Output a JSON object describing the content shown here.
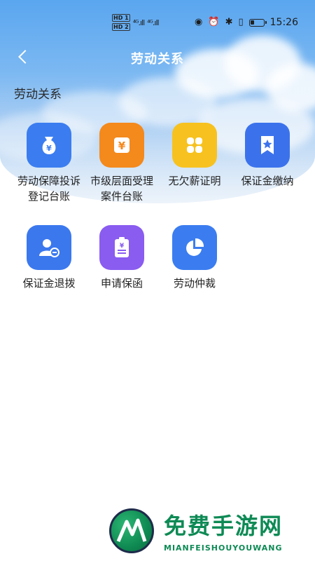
{
  "status_bar": {
    "hd1": "HD 1",
    "hd2": "HD 2",
    "signal1": "⁴ᴳ.ıll",
    "signal2": "⁴ᴳ.ıll",
    "time": "15:26",
    "icons": [
      "eye-icon",
      "alarm-icon",
      "bluetooth-icon",
      "vibrate-icon",
      "battery-icon"
    ]
  },
  "nav": {
    "title": "劳动关系",
    "back_icon": "chevron-left-icon"
  },
  "section": {
    "title": "劳动关系"
  },
  "items": [
    {
      "label": "劳动保障投诉登记台账",
      "icon": "money-bag-icon",
      "color": "#3b7df0"
    },
    {
      "label": "市级层面受理案件台账",
      "icon": "yuan-icon",
      "color": "#f4891c"
    },
    {
      "label": "无欠薪证明",
      "icon": "clover-icon",
      "color": "#f7c21f"
    },
    {
      "label": "保证金缴纳",
      "icon": "bookmark-star-icon",
      "color": "#3b72ec"
    },
    {
      "label": "保证金退拨",
      "icon": "user-minus-icon",
      "color": "#3b78ee"
    },
    {
      "label": "申请保函",
      "icon": "clipboard-yuan-icon",
      "color": "#8a5cf0"
    },
    {
      "label": "劳动仲裁",
      "icon": "pie-chart-icon",
      "color": "#3b7df0"
    }
  ],
  "watermark": {
    "cn": "免费手游网",
    "en": "MIANFEISHOUYOUWANG"
  }
}
